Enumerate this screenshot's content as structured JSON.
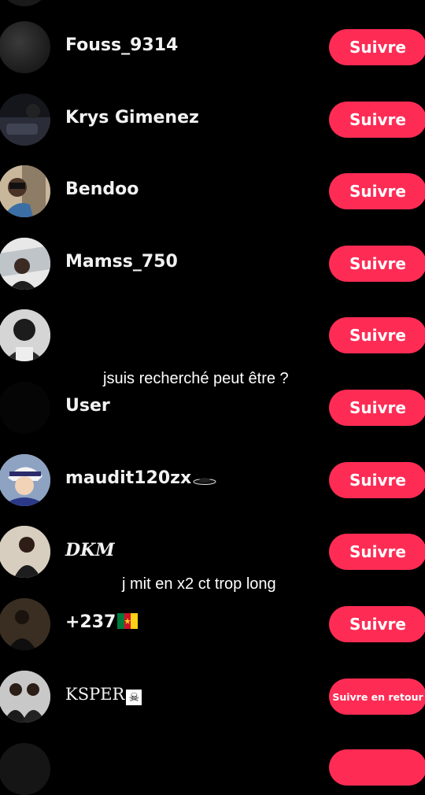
{
  "follow_list": [
    {
      "username": "Fouss_9314",
      "button": "Suivre"
    },
    {
      "username": "Krys Gimenez",
      "button": "Suivre"
    },
    {
      "username": "Bendoo",
      "button": "Suivre"
    },
    {
      "username": "Mamss_750",
      "button": "Suivre"
    },
    {
      "username": "",
      "button": "Suivre"
    },
    {
      "username": "User",
      "button": "Suivre"
    },
    {
      "username": "maudit120zx",
      "button": "Suivre"
    },
    {
      "username": "DKM",
      "button": "Suivre"
    },
    {
      "username": "+237",
      "button": "Suivre"
    },
    {
      "username": "KSPER",
      "button": "Suivre en retour"
    }
  ],
  "captions": {
    "first": "jsuis recherché peut être ?",
    "second": "j mit en x2 ct trop long"
  },
  "colors": {
    "background": "#000000",
    "button": "#fe2c55",
    "text": "#ffffff"
  }
}
